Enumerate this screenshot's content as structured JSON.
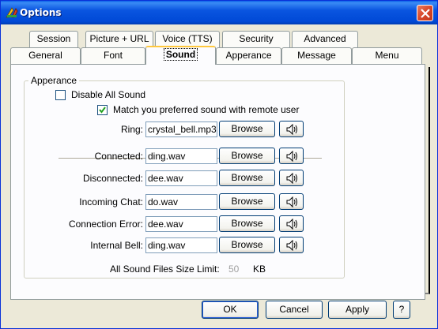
{
  "window": {
    "title": "Options"
  },
  "tabs_row1": [
    {
      "label": "Session",
      "accel": ""
    },
    {
      "label": "Picture + URL",
      "accel": ""
    },
    {
      "label": "Voice (TTS)",
      "accel": ""
    },
    {
      "label": "Security",
      "accel": ""
    },
    {
      "label": "Advanced",
      "accel": ""
    }
  ],
  "tabs_row2": [
    {
      "label": "General"
    },
    {
      "label": "Font"
    },
    {
      "label": "Sound",
      "selected": true
    },
    {
      "label": "Apperance"
    },
    {
      "label": "Message"
    },
    {
      "label": "Menu"
    }
  ],
  "group": {
    "legend": "Apperance"
  },
  "options": {
    "disable_all_sound": {
      "label": "Disable All Sound",
      "checked": false
    },
    "match_preferred": {
      "label": "Match you preferred sound with remote user",
      "checked": true
    }
  },
  "ring": {
    "label": "Ring:",
    "value": "crystal_bell.mp3",
    "browse": "Browse"
  },
  "sounds": [
    {
      "label": "Connected:",
      "value": "ding.wav",
      "browse": "Browse"
    },
    {
      "label": "Disconnected:",
      "value": "dee.wav",
      "browse": "Browse"
    },
    {
      "label": "Incoming Chat:",
      "value": "do.wav",
      "browse": "Browse"
    },
    {
      "label": "Connection Error:",
      "value": "dee.wav",
      "browse": "Browse"
    },
    {
      "label": "Internal Bell:",
      "value": "ding.wav",
      "browse": "Browse"
    }
  ],
  "size_limit": {
    "label": "All Sound Files Size Limit:",
    "value": "50",
    "unit": "KB"
  },
  "buttons": {
    "ok": "OK",
    "cancel": "Cancel",
    "apply": "Apply",
    "help": "?"
  },
  "icons": {
    "close": "close-icon",
    "speaker": "speaker-icon",
    "app": "app-icon"
  }
}
